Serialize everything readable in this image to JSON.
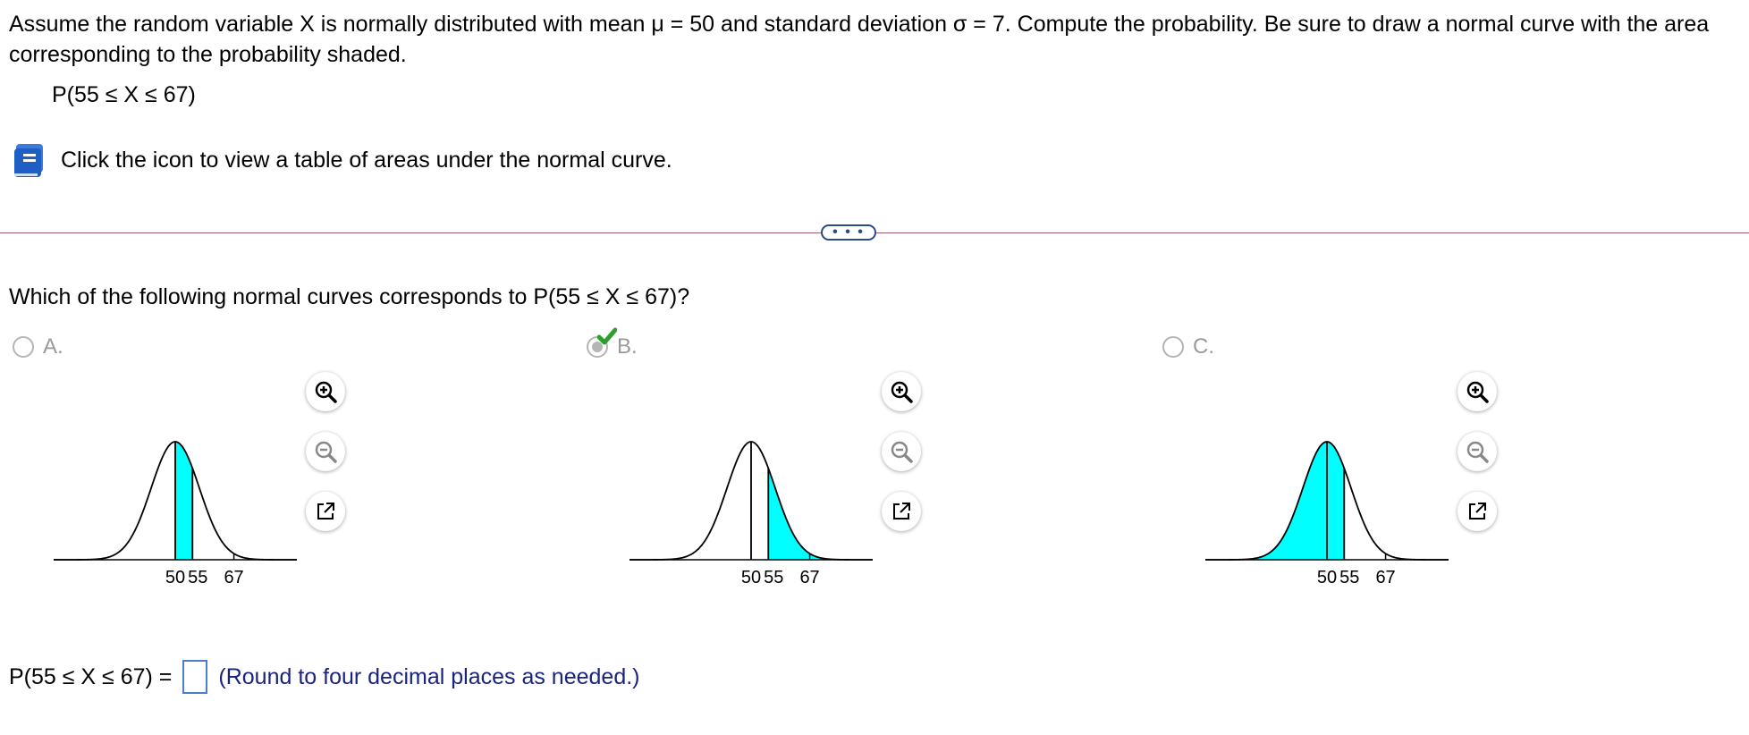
{
  "question": {
    "text": "Assume the random variable X is normally distributed with mean μ = 50 and standard deviation σ = 7. Compute the probability. Be sure to draw a normal curve with the area corresponding to the probability shaded.",
    "probability": "P(55 ≤ X ≤ 67)",
    "table_link_text": "Click the icon to view a table of areas under the normal curve."
  },
  "divider": {
    "ellipsis": "• • •"
  },
  "subquestion": {
    "text": "Which of the following normal curves corresponds to P(55 ≤ X ≤ 67)?"
  },
  "options": [
    {
      "label": "A.",
      "selected": false,
      "shaded": "50-55",
      "ticks": [
        "50",
        "55",
        "67"
      ]
    },
    {
      "label": "B.",
      "selected": true,
      "shaded": "55-upper",
      "ticks": [
        "50",
        "55",
        "67"
      ]
    },
    {
      "label": "C.",
      "selected": false,
      "shaded": "lower-55",
      "ticks": [
        "50",
        "55",
        "67"
      ]
    }
  ],
  "answer": {
    "prefix": "P(55 ≤ X ≤ 67) =",
    "value": "",
    "note": "(Round to four decimal places as needed.)"
  },
  "colors": {
    "shade": "#00ffff",
    "accent": "#2a4a8a",
    "check": "#2e9e2e",
    "note": "#1a237e"
  },
  "icons": [
    "book-icon",
    "zoom-in-icon",
    "zoom-out-icon",
    "popout-icon",
    "checkmark-icon"
  ]
}
